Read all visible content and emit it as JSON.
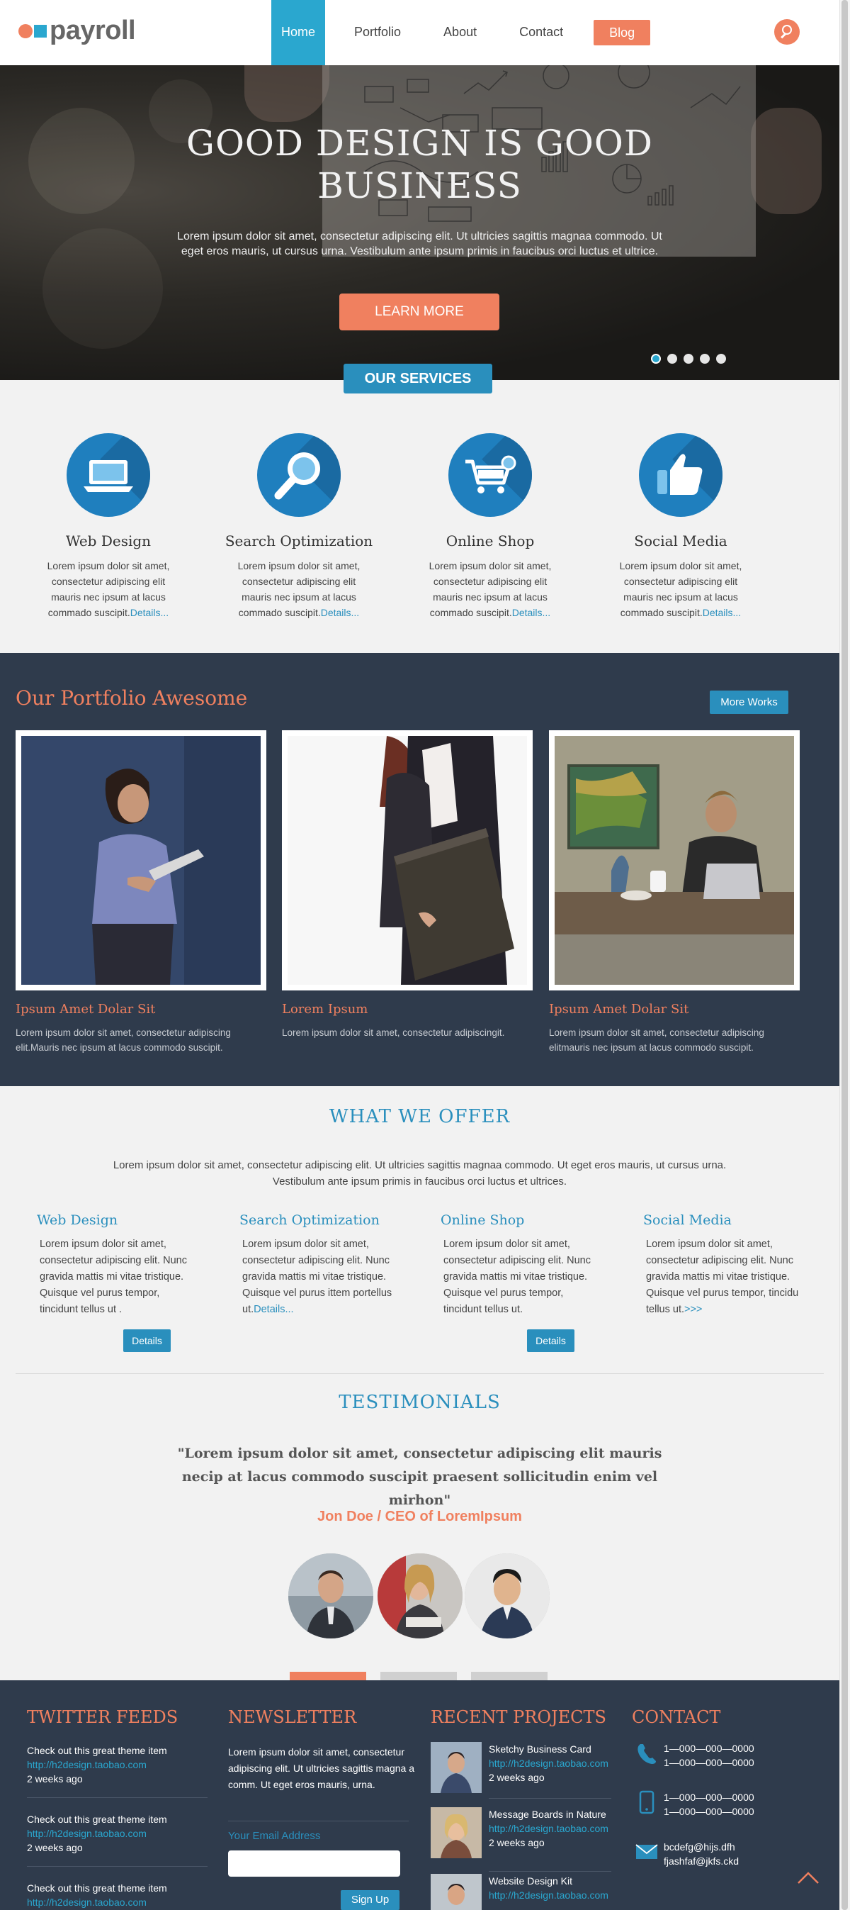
{
  "header": {
    "logo_text": "payroll",
    "nav": [
      "Home",
      "Portfolio",
      "About",
      "Contact",
      "Blog"
    ],
    "active": "Home"
  },
  "hero": {
    "title_line1": "GOOD DESIGN IS GOOD",
    "title_line2": "BUSINESS",
    "text": "Lorem ipsum dolor sit amet, consectetur adipiscing elit. Ut ultricies sagittis magnaa commodo. Ut eget eros mauris, ut cursus urna. Vestibulum ante ipsum primis in faucibus orci luctus et ultrice.",
    "cta": "LEARN MORE",
    "slides": 5,
    "active_slide": 1
  },
  "services": {
    "tab_label": "OUR SERVICES",
    "items": [
      {
        "icon": "laptop-icon",
        "title": "Web Design",
        "text": "Lorem ipsum dolor sit amet, consectetur adipiscing elit mauris nec ipsum at lacus commado suscipit.",
        "link": "Details..."
      },
      {
        "icon": "magnifier-icon",
        "title": "Search Optimization",
        "text": "Lorem ipsum dolor sit amet, consectetur adipiscing elit mauris nec ipsum at lacus commado suscipit.",
        "link": "Details..."
      },
      {
        "icon": "cart-icon",
        "title": "Online Shop",
        "text": "Lorem ipsum dolor sit amet, consectetur adipiscing elit mauris nec ipsum at lacus commado suscipit.",
        "link": "Details..."
      },
      {
        "icon": "thumbs-up-icon",
        "title": "Social Media",
        "text": "Lorem ipsum dolor sit amet, consectetur adipiscing elit mauris nec ipsum at lacus commado suscipit.",
        "link": "Details..."
      }
    ]
  },
  "portfolio": {
    "title": "Our Portfolio Awesome",
    "more_button": "More Works",
    "items": [
      {
        "title": "Ipsum Amet Dolar Sit",
        "text": "Lorem ipsum dolor sit amet, consectetur adipiscing elit.Mauris nec ipsum at lacus commodo suscipit."
      },
      {
        "title": "Lorem Ipsum",
        "text": "Lorem ipsum dolor sit amet, consectetur adipiscingit."
      },
      {
        "title": "Ipsum Amet Dolar Sit",
        "text": "Lorem ipsum dolor sit amet, consectetur adipiscing elitmauris nec ipsum at lacus commodo suscipit."
      }
    ]
  },
  "offer": {
    "title": "WHAT WE OFFER",
    "intro": "Lorem ipsum dolor sit amet, consectetur adipiscing elit. Ut ultricies sagittis magnaa commodo. Ut eget eros mauris, ut cursus urna. Vestibulum ante ipsum primis in faucibus orci luctus et ultrices.",
    "items": [
      {
        "title": "Web Design",
        "text": "Lorem ipsum dolor sit amet, consectetur adipiscing elit. Nunc gravida mattis mi vitae tristique. Quisque vel purus tempor, tincidunt tellus ut .",
        "link": ""
      },
      {
        "title": "Search Optimization",
        "text": "Lorem ipsum dolor sit amet, consectetur adipiscing elit. Nunc gravida mattis mi vitae tristique. Quisque vel purus ittem portellus ut.",
        "link": "Details..."
      },
      {
        "title": "Online Shop",
        "text": "Lorem ipsum dolor sit amet, consectetur adipiscing elit. Nunc gravida mattis mi vitae tristique. Quisque vel purus tempor, tincidunt tellus ut.",
        "link": ""
      },
      {
        "title": "Social Media",
        "text": "Lorem ipsum dolor sit amet, consectetur adipiscing elit. Nunc gravida mattis mi vitae tristique. Quisque vel purus tempor, tincidu tellus ut.",
        "link": ">>>"
      }
    ],
    "details_button": "Details"
  },
  "testimonials": {
    "title": "TESTIMONIALS",
    "quote": "\"Lorem ipsum dolor sit amet, consectetur adipiscing elit mauris necip at lacus commodo suscipit praesent sollicitudin enim vel mirhon\"",
    "author": "Jon Doe / CEO of LoremIpsum"
  },
  "footer": {
    "twitter": {
      "title": "TWITTER FEEDS",
      "items": [
        {
          "text": "Check out this great theme item",
          "link": "http://h2design.taobao.com",
          "time": "2 weeks ago"
        },
        {
          "text": "Check out this great theme item",
          "link": "http://h2design.taobao.com",
          "time": "2 weeks ago"
        },
        {
          "text": "Check out this great theme item",
          "link": "http://h2design.taobao.com",
          "time": ""
        }
      ]
    },
    "newsletter": {
      "title": "NEWSLETTER",
      "text": "Lorem ipsum dolor sit amet, consectetur adipiscing elit. Ut ultricies sagittis magna a comm. Ut eget eros mauris, urna.",
      "email_label": "Your Email Address",
      "email_value": "",
      "button": "Sign Up"
    },
    "projects": {
      "title": "RECENT PROJECTS",
      "items": [
        {
          "name": "Sketchy Business Card",
          "link": "http://h2design.taobao.com",
          "time": "2 weeks ago"
        },
        {
          "name": "Message Boards in Nature",
          "link": "http://h2design.taobao.com",
          "time": "2 weeks ago"
        },
        {
          "name": "Website Design Kit",
          "link": "http://h2design.taobao.com",
          "time": ""
        }
      ]
    },
    "contact": {
      "title": "CONTACT",
      "phone": [
        "1—000—000—0000",
        "1—000—000—0000"
      ],
      "mobile": [
        "1—000—000—0000",
        "1—000—000—0000"
      ],
      "email": [
        "bcdefg@hijs.dfh",
        "fjashfaf@jkfs.ckd"
      ]
    }
  },
  "colors": {
    "accent_orange": "#f0805f",
    "accent_blue": "#2a8fbd",
    "dark_navy": "#2f3b4c"
  }
}
